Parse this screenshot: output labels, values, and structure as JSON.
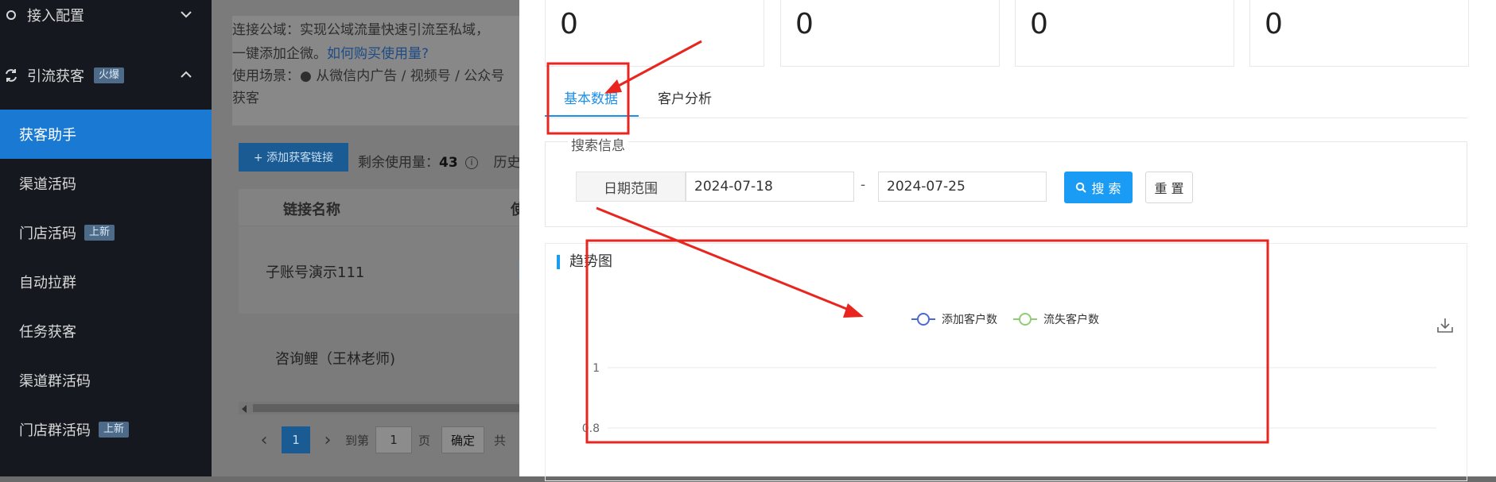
{
  "sidebar": {
    "group_access": {
      "label": "接入配置"
    },
    "group_traffic": {
      "label": "引流获客",
      "badge": "火爆"
    },
    "items": [
      {
        "label": "获客助手",
        "badge": ""
      },
      {
        "label": "渠道活码",
        "badge": ""
      },
      {
        "label": "门店活码",
        "badge": "上新"
      },
      {
        "label": "自动拉群",
        "badge": ""
      },
      {
        "label": "任务获客",
        "badge": ""
      },
      {
        "label": "渠道群活码",
        "badge": ""
      },
      {
        "label": "门店群活码",
        "badge": "上新"
      }
    ]
  },
  "main": {
    "notice": {
      "line1": "连接公域：实现公域流量快速引流至私域，",
      "line2_prefix": "一键添加企微。",
      "line2_link": "如何购买使用量?",
      "line3": "使用场景：● 从微信内广告 / 视频号 / 公众号",
      "line4": "获客"
    },
    "add_button": "+ 添加获客链接",
    "remaining_label": "剩余使用量：",
    "remaining_value": "43",
    "history_label": "历史",
    "table": {
      "headers": [
        "链接名称",
        "使"
      ],
      "rows": [
        {
          "name": "子账号演示111"
        },
        {
          "name": "咨询鲤（王林老师)"
        }
      ]
    },
    "pager": {
      "current_page": "1",
      "goto_label": "到第",
      "goto_value": "1",
      "page_label": "页",
      "confirm": "确定",
      "total_prefix": "共"
    }
  },
  "drawer": {
    "stats": [
      "0",
      "0",
      "0",
      "0"
    ],
    "tabs": [
      {
        "label": "基本数据",
        "active": true
      },
      {
        "label": "客户分析",
        "active": false
      }
    ],
    "search": {
      "title": "搜索信息",
      "date_label": "日期范围",
      "start_date": "2024-07-18",
      "separator": "-",
      "end_date": "2024-07-25",
      "search_button": "搜 索",
      "reset_button": "重 置"
    },
    "trend": {
      "title": "趋势图"
    }
  },
  "chart_data": {
    "type": "line",
    "title": "",
    "series": [
      {
        "name": "添加客户数",
        "color": "#4a6ad1",
        "values": []
      },
      {
        "name": "流失客户数",
        "color": "#91cc75",
        "values": []
      }
    ],
    "y_tick_labels": [
      "1",
      "0.8"
    ],
    "ylim": [
      0.8,
      1
    ],
    "legend_position": "top-center",
    "grid": true
  },
  "colors": {
    "accent": "#1a9cf5",
    "sidebar_bg": "#15181e",
    "sidebar_active": "#1a7ad3",
    "annotation_red": "#e8251f"
  }
}
